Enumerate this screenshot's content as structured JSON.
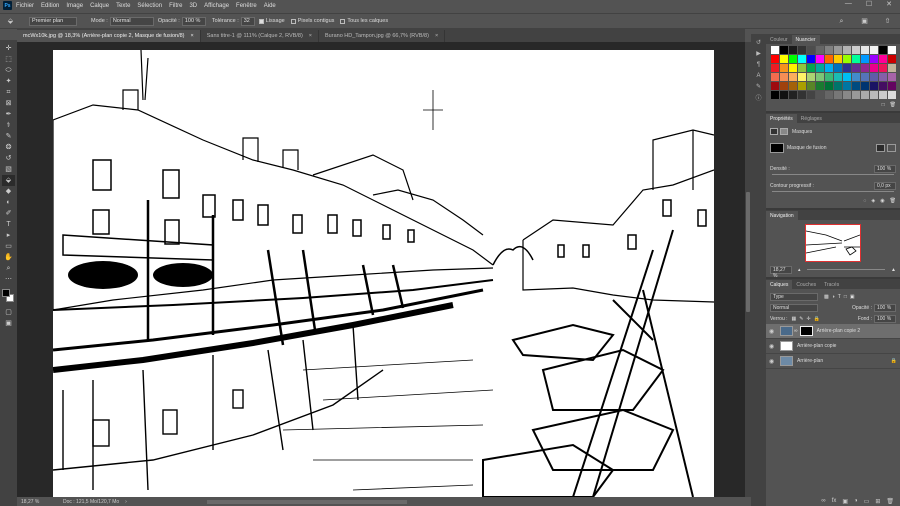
{
  "menubar": {
    "logo": "Ps",
    "items": [
      "Fichier",
      "Edition",
      "Image",
      "Calque",
      "Texte",
      "Sélection",
      "Filtre",
      "3D",
      "Affichage",
      "Fenêtre",
      "Aide"
    ],
    "window_controls": [
      "—",
      "☐",
      "✕"
    ]
  },
  "options": {
    "sample_label": "Premier plan",
    "mode_label": "Mode :",
    "mode_value": "Normal",
    "opacity_label": "Opacité :",
    "opacity_value": "100 %",
    "tolerance_label": "Tolérance :",
    "tolerance_value": "32",
    "smoothing_label": "Lissage",
    "contiguous_label": "Pixels contigus",
    "all_layers_label": "Tous les calques"
  },
  "tabs": [
    {
      "label": "mcWx10k.jpg @ 18,3% (Arrière-plan copie 2, Masque de fusion/8)",
      "close": "×"
    },
    {
      "label": "Sans titre-1 @ 111% (Calque 2, RVB/8)",
      "close": "×"
    },
    {
      "label": "Burano HD_Tampon.jpg @ 66,7% (RVB/8)",
      "close": "×"
    }
  ],
  "status": {
    "zoom": "18,27 %",
    "doc": "Doc : 121,5 Mo/120,7 Mo"
  },
  "swatch_panel": {
    "tab_color": "Couleur",
    "tab_swatches": "Nuancier"
  },
  "properties": {
    "tab_props": "Propriétés",
    "tab_adjust": "Réglages",
    "masks_label": "Masques",
    "mask_type": "Masque de fusion",
    "density_label": "Densité :",
    "density_value": "100 %",
    "feather_label": "Contour progressif :",
    "feather_value": "0,0 px"
  },
  "navigation": {
    "title": "Navigation",
    "zoom": "18,27 %"
  },
  "layers": {
    "tab_layers": "Calques",
    "tab_channels": "Couches",
    "tab_paths": "Tracés",
    "kind": "Type",
    "blend": "Normal",
    "opacity_label": "Opacité :",
    "opacity_value": "100 %",
    "lock_label": "Verrou :",
    "fill_label": "Fond :",
    "fill_value": "100 %",
    "items": [
      {
        "name": "Arrière-plan copie 2",
        "selected": true
      },
      {
        "name": "Arrière-plan copie",
        "selected": false
      },
      {
        "name": "Arrière-plan",
        "selected": false
      }
    ]
  },
  "swatch_colors": [
    "#ffffff",
    "#000000",
    "#404040",
    "#808080",
    "#c0c0c0",
    "#ff0000",
    "#ffff00",
    "#00ff00",
    "#00ffff",
    "#0000ff",
    "#ff00ff",
    "#ff8000",
    "#8000ff",
    "#00ff80"
  ]
}
